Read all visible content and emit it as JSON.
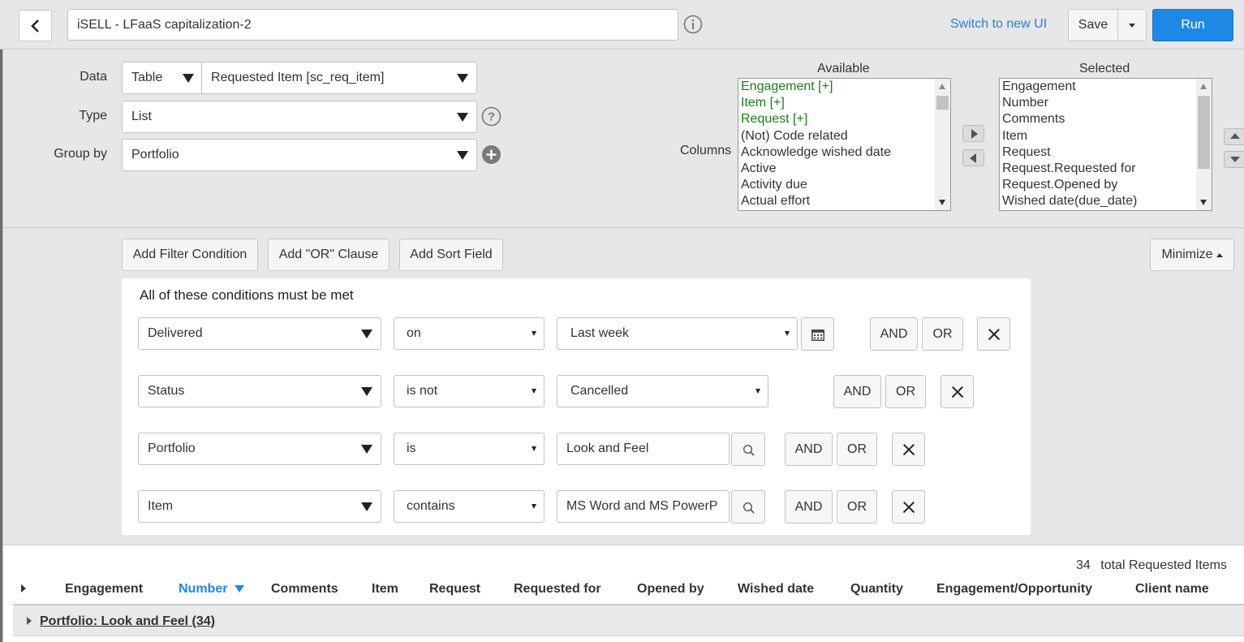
{
  "header": {
    "back_label": "<",
    "title_value": "iSELL - LFaaS capitalization-2",
    "switch_ui": "Switch to new UI",
    "save_label": "Save",
    "run_label": "Run"
  },
  "config": {
    "data_label": "Data",
    "data_source_type": "Table",
    "data_table": "Requested Item [sc_req_item]",
    "type_label": "Type",
    "type_value": "List",
    "groupby_label": "Group by",
    "groupby_value": "Portfolio",
    "columns_label": "Columns",
    "available_label": "Available",
    "selected_label": "Selected",
    "available_items": [
      {
        "text": "Engagement [+]",
        "expandable": true
      },
      {
        "text": "Item [+]",
        "expandable": true
      },
      {
        "text": "Request [+]",
        "expandable": true
      },
      {
        "text": "(Not) Code related",
        "expandable": false
      },
      {
        "text": "Acknowledge wished date",
        "expandable": false
      },
      {
        "text": "Active",
        "expandable": false
      },
      {
        "text": "Activity due",
        "expandable": false
      },
      {
        "text": "Actual effort",
        "expandable": false
      }
    ],
    "selected_items": [
      "Engagement",
      "Number",
      "Comments",
      "Item",
      "Request",
      "Request.Requested for",
      "Request.Opened by",
      "Wished date(due_date)"
    ]
  },
  "filter": {
    "add_filter": "Add Filter Condition",
    "add_or": "Add \"OR\" Clause",
    "add_sort": "Add Sort Field",
    "minimize": "Minimize",
    "heading": "All of these conditions must be met",
    "and_label": "AND",
    "or_label": "OR",
    "conditions": [
      {
        "field": "Delivered",
        "operator": "on",
        "value": "Last week"
      },
      {
        "field": "Status",
        "operator": "is not",
        "value": "Cancelled"
      },
      {
        "field": "Portfolio",
        "operator": "is",
        "value": "Look and Feel"
      },
      {
        "field": "Item",
        "operator": "contains",
        "value": "MS Word and MS PowerP"
      }
    ]
  },
  "results": {
    "count": "34",
    "count_label": "total Requested Items",
    "columns": [
      "Engagement",
      "Number",
      "Comments",
      "Item",
      "Request",
      "Requested for",
      "Opened by",
      "Wished date",
      "Quantity",
      "Engagement/Opportunity",
      "Client name"
    ],
    "sorted_column": "Number",
    "group_label": "Portfolio: Look and Feel (34)"
  },
  "colors": {
    "accent": "#1e88e5",
    "link": "#2d7fd3",
    "available_expandable": "#1a7f1a"
  }
}
